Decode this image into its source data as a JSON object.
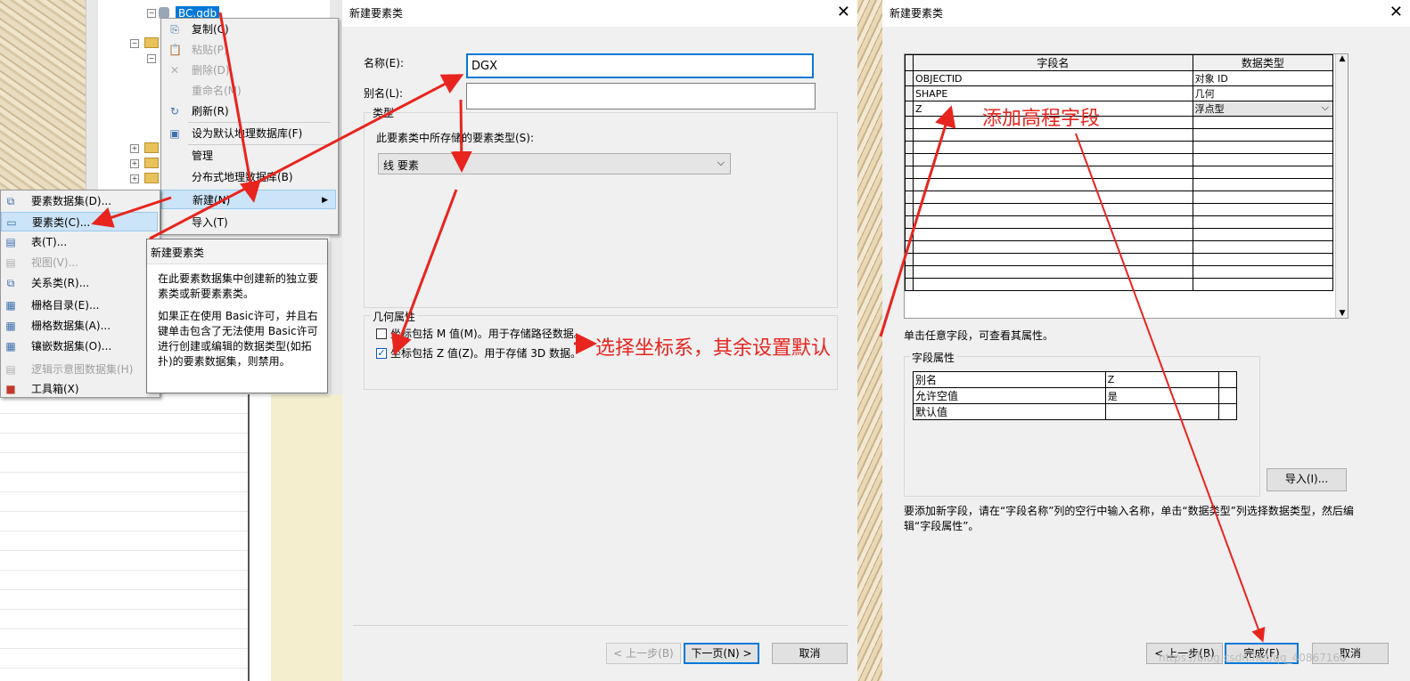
{
  "tree": {
    "gdb_label": "BC.gdb"
  },
  "context_menu": {
    "items": [
      {
        "label": "复制(C)",
        "disabled": false,
        "icon": "copy-icon",
        "glyph": "⎘"
      },
      {
        "label": "粘贴(P)",
        "disabled": true,
        "icon": "paste-icon",
        "glyph": "📋"
      },
      {
        "label": "删除(D)",
        "disabled": true,
        "icon": "delete-icon",
        "glyph": "✕"
      },
      {
        "label": "重命名(M)",
        "disabled": true,
        "icon": "",
        "glyph": ""
      },
      {
        "label": "刷新(R)",
        "disabled": false,
        "icon": "refresh-icon",
        "glyph": "↻"
      },
      {
        "label": "设为默认地理数据库(F)",
        "disabled": false,
        "icon": "default-gdb-icon",
        "glyph": "▣"
      },
      {
        "label": "管理",
        "disabled": false,
        "icon": "",
        "glyph": "",
        "submenu": true
      },
      {
        "label": "分布式地理数据库(B)",
        "disabled": false,
        "icon": "",
        "glyph": "",
        "submenu": true
      },
      {
        "label": "新建(N)",
        "disabled": false,
        "icon": "",
        "glyph": "",
        "submenu": true,
        "selected": true
      },
      {
        "label": "导入(T)",
        "disabled": false,
        "icon": "",
        "glyph": "",
        "submenu": true
      }
    ]
  },
  "submenu": {
    "items": [
      {
        "label": "要素数据集(D)...",
        "disabled": false,
        "icon": "feature-dataset-icon",
        "glyph": "⧉"
      },
      {
        "label": "要素类(C)...",
        "disabled": false,
        "icon": "feature-class-icon",
        "glyph": "▭",
        "selected": true
      },
      {
        "label": "表(T)...",
        "disabled": false,
        "icon": "table-icon",
        "glyph": "▤"
      },
      {
        "label": "视图(V)...",
        "disabled": true,
        "icon": "view-icon",
        "glyph": "▤"
      },
      {
        "label": "关系类(R)...",
        "disabled": false,
        "icon": "relationship-class-icon",
        "glyph": "⧉"
      },
      {
        "label": "栅格目录(E)...",
        "disabled": false,
        "icon": "raster-catalog-icon",
        "glyph": "▦"
      },
      {
        "label": "栅格数据集(A)...",
        "disabled": false,
        "icon": "raster-dataset-icon",
        "glyph": "▦"
      },
      {
        "label": "镶嵌数据集(O)...",
        "disabled": false,
        "icon": "mosaic-dataset-icon",
        "glyph": "▦"
      },
      {
        "label": "逻辑示意图数据集(H)",
        "disabled": true,
        "icon": "schematic-dataset-icon",
        "glyph": "▤"
      },
      {
        "label": "工具箱(X)",
        "disabled": false,
        "icon": "toolbox-icon",
        "glyph": "■"
      }
    ]
  },
  "tooltip": {
    "title": "新建要素类",
    "p1": "在此要素数据集中创建新的独立要素类或新要素素类。",
    "p2": "如果正在使用 Basic许可，并且右键单击包含了无法使用 Basic许可进行创建或编辑的数据类型(如拓扑)的要素数据集，则禁用。"
  },
  "dialog1": {
    "title": "新建要素类",
    "name_label": "名称(E):",
    "name_value": "DGX",
    "alias_label": "别名(L):",
    "alias_value": "",
    "type_group": "类型",
    "type_prompt": "此要素类中所存储的要素类型(S):",
    "type_value": "线 要素",
    "geom_group": "几何属性",
    "m_label": "坐标包括 M 值(M)。用于存储路径数据。",
    "m_checked": false,
    "z_label": "坐标包括 Z 值(Z)。用于存储 3D 数据。",
    "z_checked": true,
    "back": "< 上一步(B)",
    "next": "下一页(N) >",
    "cancel": "取消"
  },
  "dialog2": {
    "title": "新建要素类",
    "columns": [
      "字段名",
      "数据类型"
    ],
    "rows": [
      {
        "field": "OBJECTID",
        "type": "对象 ID"
      },
      {
        "field": "SHAPE",
        "type": "几何"
      },
      {
        "field": "Z",
        "type": "浮点型"
      }
    ],
    "hint": "单击任意字段，可查看其属性。",
    "props_group": "字段属性",
    "props": [
      {
        "name": "别名",
        "value": "Z"
      },
      {
        "name": "允许空值",
        "value": "是"
      },
      {
        "name": "默认值",
        "value": ""
      }
    ],
    "import": "导入(I)...",
    "instructions": "要添加新字段，请在“字段名称”列的空行中输入名称，单击“数据类型”列选择数据类型，然后编辑“字段属性”。",
    "back": "< 上一步(B)",
    "finish": "完成(F)",
    "cancel": "取消"
  },
  "annotations": {
    "coord": "选择坐标系，其余设置默认",
    "elev": "添加高程字段"
  },
  "watermark": "https://blog.csdn.net/qq_40867160",
  "colors": {
    "annotation": "#e8241e",
    "selection": "#cce4f7",
    "accent": "#0078d7"
  }
}
